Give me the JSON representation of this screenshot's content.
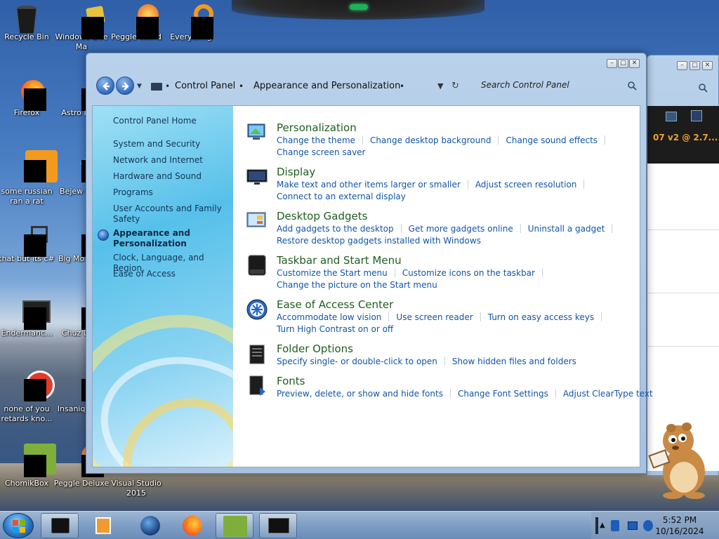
{
  "desktop": {
    "icons": [
      {
        "label": "Recycle Bin",
        "name": "recycle-bin-icon"
      },
      {
        "label": "Windows Live Ma",
        "name": "windows-live-mail-icon"
      },
      {
        "label": "Peggle World",
        "name": "peggle-world-icon"
      },
      {
        "label": "Everything",
        "name": "everything-icon"
      },
      {
        "label": "Firefox",
        "name": "firefox-icon"
      },
      {
        "label": "Astro Delu",
        "name": "astro-deluxe-icon"
      },
      {
        "label": "some russian ran a rat",
        "name": "some-russian-icon"
      },
      {
        "label": "Bejew Delu",
        "name": "bejeweled-deluxe-icon"
      },
      {
        "label": "that but its c#",
        "name": "that-but-its-csharp-icon"
      },
      {
        "label": "Big Mo Delu",
        "name": "big-money-deluxe-icon"
      },
      {
        "label": "Endermanc...",
        "name": "endermanch-icon"
      },
      {
        "label": "Chuz Delu",
        "name": "chuzzle-deluxe-icon"
      },
      {
        "label": "none of you retards kno...",
        "name": "none-of-you-icon"
      },
      {
        "label": "Insaniq Delu",
        "name": "insaniquarium-deluxe-icon"
      },
      {
        "label": "ChomikBox",
        "name": "chomikbox-icon"
      },
      {
        "label": "Peggle Deluxe",
        "name": "peggle-deluxe-icon"
      },
      {
        "label": "Visual Studio 2015",
        "name": "visual-studio-2015-icon"
      }
    ]
  },
  "window": {
    "breadcrumb": [
      "Control Panel",
      "Appearance and Personalization"
    ],
    "search_placeholder": "Search Control Panel",
    "controls": {
      "minimize": "–",
      "maximize": "□",
      "close": "✕"
    }
  },
  "sidebar": {
    "items": [
      {
        "label": "Control Panel Home",
        "active": false
      },
      {
        "label": "System and Security",
        "active": false
      },
      {
        "label": "Network and Internet",
        "active": false
      },
      {
        "label": "Hardware and Sound",
        "active": false
      },
      {
        "label": "Programs",
        "active": false
      },
      {
        "label": "User Accounts and Family Safety",
        "active": false
      },
      {
        "label": "Appearance and Personalization",
        "active": true
      },
      {
        "label": "Clock, Language, and Region",
        "active": false
      },
      {
        "label": "Ease of Access",
        "active": false
      }
    ]
  },
  "categories": [
    {
      "title": "Personalization",
      "rows": [
        [
          "Change the theme",
          "Change desktop background",
          "Change sound effects"
        ],
        [
          "Change screen saver"
        ]
      ]
    },
    {
      "title": "Display",
      "rows": [
        [
          "Make text and other items larger or smaller",
          "Adjust screen resolution"
        ],
        [
          "Connect to an external display"
        ]
      ]
    },
    {
      "title": "Desktop Gadgets",
      "rows": [
        [
          "Add gadgets to the desktop",
          "Get more gadgets online",
          "Uninstall a gadget"
        ],
        [
          "Restore desktop gadgets installed with Windows"
        ]
      ]
    },
    {
      "title": "Taskbar and Start Menu",
      "rows": [
        [
          "Customize the Start menu",
          "Customize icons on the taskbar"
        ],
        [
          "Change the picture on the Start menu"
        ]
      ]
    },
    {
      "title": "Ease of Access Center",
      "rows": [
        [
          "Accommodate low vision",
          "Use screen reader",
          "Turn on easy access keys"
        ],
        [
          "Turn High Contrast on or off"
        ]
      ]
    },
    {
      "title": "Folder Options",
      "rows": [
        [
          "Specify single- or double-click to open",
          "Show hidden files and folders"
        ]
      ]
    },
    {
      "title": "Fonts",
      "rows": [
        [
          "Preview, delete, or show and hide fonts",
          "Change Font Settings",
          "Adjust ClearType text"
        ]
      ]
    }
  ],
  "background_window": {
    "text": "07 v2 @ 2.7..."
  },
  "taskbar": {
    "time": "5:52 PM",
    "date": "10/16/2024"
  },
  "colors": {
    "link": "#1155a8",
    "category_title": "#1e5e1e"
  }
}
